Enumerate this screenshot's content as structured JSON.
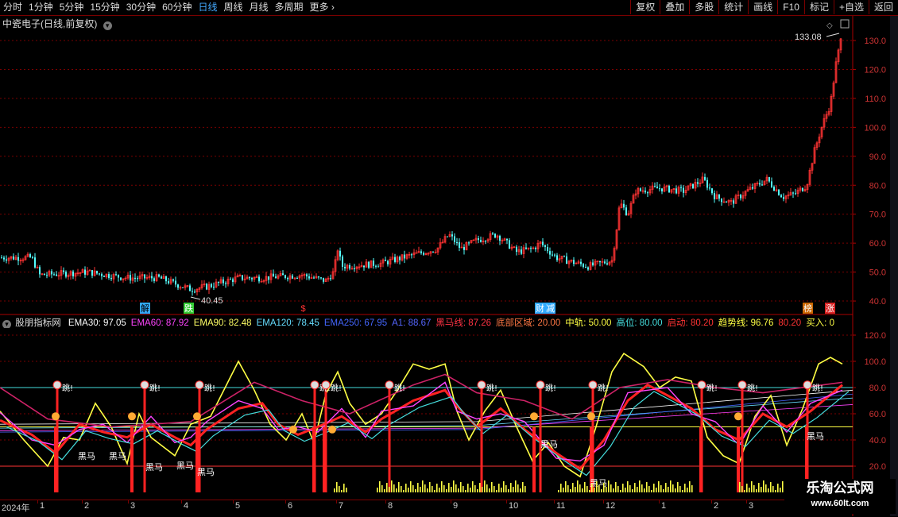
{
  "toolbar": {
    "periods": [
      "分时",
      "1分钟",
      "5分钟",
      "15分钟",
      "30分钟",
      "60分钟",
      "日线",
      "周线",
      "月线",
      "多周期",
      "更多"
    ],
    "active_period": "日线",
    "buttons": [
      "复权",
      "叠加",
      "多股",
      "统计",
      "画线",
      "F10",
      "标记",
      "+自选",
      "返回"
    ]
  },
  "stock": {
    "title": "中瓷电子(日线,前复权)",
    "high_label": "133.08",
    "low_label": "40.45"
  },
  "upper_axis": {
    "ticks": [
      "130.0",
      "120.0",
      "110.0",
      "100.0",
      "90.0",
      "80.0",
      "70.0",
      "60.0",
      "50.0",
      "40.0"
    ]
  },
  "lower_axis": {
    "ticks": [
      "120.0",
      "100.0",
      "80.0",
      "60.0",
      "40.0",
      "20.0"
    ]
  },
  "event_markers": [
    "解",
    "跌",
    "$",
    "财",
    "减",
    "榜",
    "涨"
  ],
  "indicator": {
    "name": "股朋指标网",
    "values": [
      {
        "label": "EMA30: 97.05",
        "color": "#ffffff"
      },
      {
        "label": "EMA60: 87.92",
        "color": "#ff44ff"
      },
      {
        "label": "EMA90: 82.48",
        "color": "#ffff66"
      },
      {
        "label": "EMA120: 78.45",
        "color": "#66ddff"
      },
      {
        "label": "EMA250: 67.95",
        "color": "#4466ff"
      },
      {
        "label": "A1: 88.67",
        "color": "#5566ff"
      },
      {
        "label": "黑马线: 87.26",
        "color": "#ff3344"
      },
      {
        "label": "底部区域: 20.00",
        "color": "#ff7744"
      },
      {
        "label": "中轨: 50.00",
        "color": "#ffff44"
      },
      {
        "label": "高位: 80.00",
        "color": "#44dddd"
      },
      {
        "label": "启动: 80.20",
        "color": "#ff3333"
      },
      {
        "label": "趋势线: 96.76",
        "color": "#ffff44"
      },
      {
        "label": "80.20",
        "color": "#ff3333"
      },
      {
        "label": "买入: 0",
        "color": "#ffff44"
      }
    ]
  },
  "signals": {
    "jump": "跳",
    "dark_horse": "黑马"
  },
  "date_axis": [
    "2024年",
    "1",
    "2",
    "3",
    "4",
    "5",
    "6",
    "7",
    "8",
    "9",
    "10",
    "11",
    "12",
    "1",
    "2",
    "3"
  ],
  "watermark": {
    "line1": "乐淘公式网",
    "line2": "www.60lt.com"
  },
  "colors": {
    "up": "#ff3333",
    "down": "#54ffff",
    "grid": "#7a0000"
  }
}
